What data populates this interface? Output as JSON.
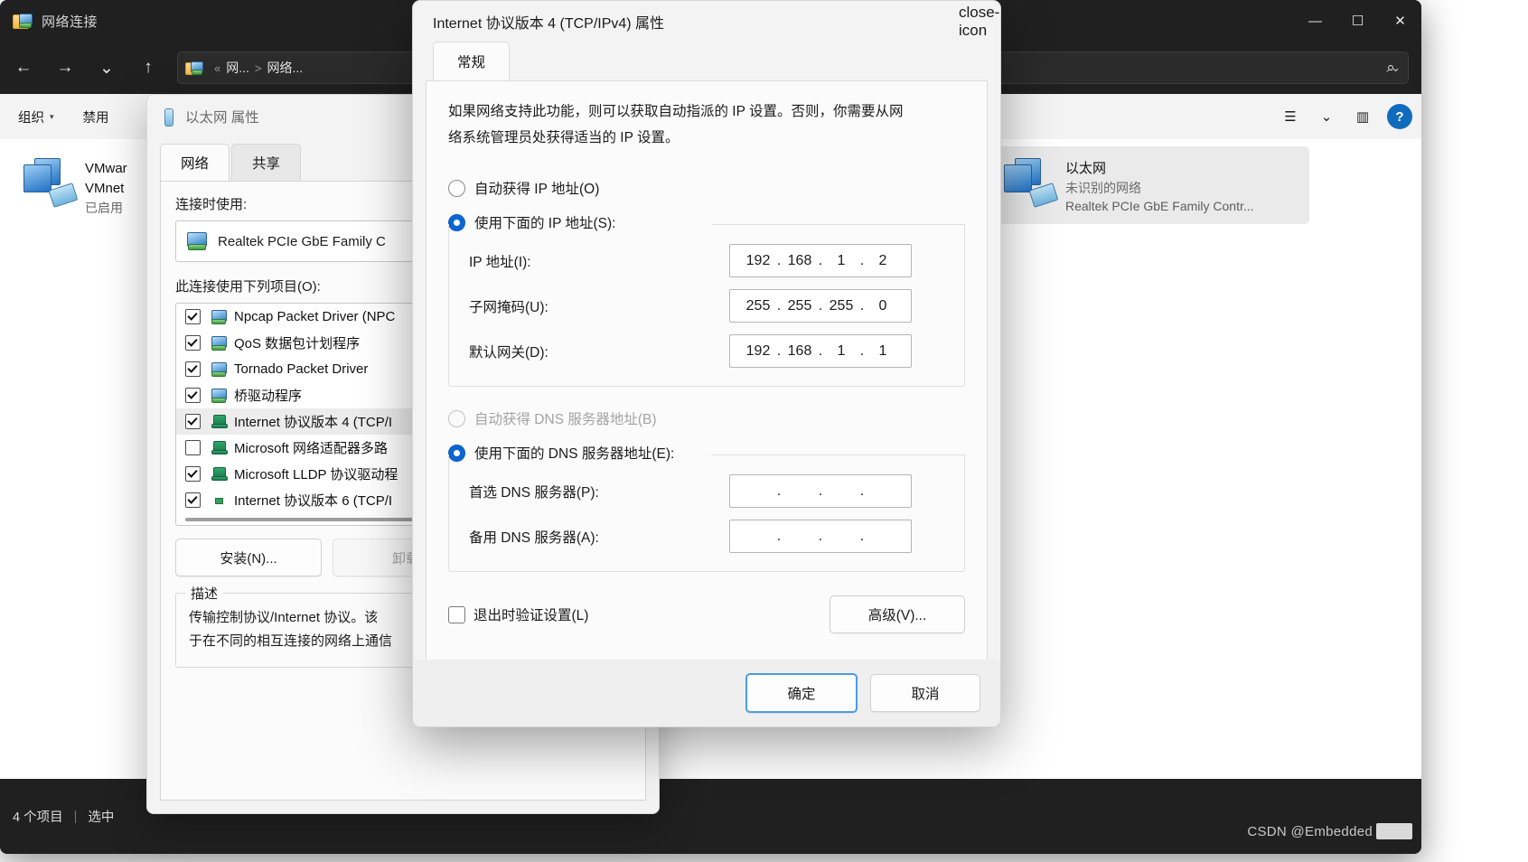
{
  "explorer": {
    "title": "网络连接",
    "title_icon": "network-folder-icon",
    "nav": {
      "back_icon": "arrow-left-icon",
      "forward_icon": "arrow-right-icon",
      "recent_icon": "chevron-down-icon",
      "up_icon": "arrow-up-icon",
      "search_icon": "search-icon"
    },
    "address": {
      "icon": "network-folder-icon",
      "overflow": "«",
      "crumb1": "网...",
      "separator": ">",
      "crumb2": "网络...",
      "chevron": "⌄"
    },
    "window_controls": {
      "minimize": "—",
      "maximize": "☐",
      "close": "✕"
    },
    "commandbar": {
      "organize": "组织",
      "organize_caret": "▾",
      "disable": "禁用",
      "view_icon": "view-options-icon",
      "view_caret": "▾",
      "pane_icon": "details-pane-icon",
      "help_icon": "?"
    },
    "items": [
      {
        "icon": "network-adapter-icon",
        "name": "VMwar",
        "name2": "VMnet",
        "status": "已启用"
      },
      {
        "icon": "network-adapter-icon",
        "name": "以太网",
        "status": "未识别的网络",
        "adapter": "Realtek PCIe GbE Family Contr..."
      }
    ],
    "statusbar": {
      "count": "4 个项目",
      "divider": "|",
      "selection": "选中"
    }
  },
  "ethernet_dialog": {
    "title": "以太网 属性",
    "title_icon": "network-cable-icon",
    "tabs": [
      {
        "label": "网络",
        "active": true
      },
      {
        "label": "共享",
        "active": false
      }
    ],
    "connect_using_label": "连接时使用:",
    "adapter": {
      "icon": "adapter-icon",
      "name": "Realtek PCIe GbE Family C"
    },
    "items_label": "此连接使用下列项目(O):",
    "protocols": [
      {
        "checked": true,
        "icon": "adapter-icon",
        "label": "Npcap Packet Driver (NPC",
        "selected": false
      },
      {
        "checked": true,
        "icon": "adapter-icon",
        "label": "QoS 数据包计划程序",
        "selected": false
      },
      {
        "checked": true,
        "icon": "adapter-icon",
        "label": "Tornado Packet Driver",
        "selected": false
      },
      {
        "checked": true,
        "icon": "adapter-icon",
        "label": "桥驱动程序",
        "selected": false
      },
      {
        "checked": true,
        "icon": "protocol-icon",
        "label": "Internet 协议版本 4 (TCP/I",
        "selected": true
      },
      {
        "checked": false,
        "icon": "protocol-icon",
        "label": "Microsoft 网络适配器多路",
        "selected": false
      },
      {
        "checked": true,
        "icon": "protocol-icon",
        "label": "Microsoft LLDP 协议驱动程",
        "selected": false
      },
      {
        "checked": true,
        "icon": "protocol-icon",
        "label": "Internet 协议版本 6 (TCP/I",
        "selected": false
      }
    ],
    "install_button": "安装(N)...",
    "uninstall_button": "卸载",
    "description_title": "描述",
    "description_line1": "传输控制协议/Internet 协议。该",
    "description_line2": "于在不同的相互连接的网络上通信"
  },
  "ipv4_dialog": {
    "title": "Internet 协议版本 4 (TCP/IPv4) 属性",
    "close_icon": "close-icon",
    "tab_general": "常规",
    "intro_line1": "如果网络支持此功能，则可以获取自动指派的 IP 设置。否则，你需要从网",
    "intro_line2": "络系统管理员处获得适当的 IP 设置。",
    "ip_auto_label": "自动获得 IP 地址(O)",
    "ip_manual_label": "使用下面的 IP 地址(S):",
    "ip_mode": "manual",
    "fields": [
      {
        "label": "IP 地址(I):",
        "octets": [
          "192",
          "168",
          "1",
          "2"
        ]
      },
      {
        "label": "子网掩码(U):",
        "octets": [
          "255",
          "255",
          "255",
          "0"
        ]
      },
      {
        "label": "默认网关(D):",
        "octets": [
          "192",
          "168",
          "1",
          "1"
        ]
      }
    ],
    "dns_auto_label": "自动获得 DNS 服务器地址(B)",
    "dns_manual_label": "使用下面的 DNS 服务器地址(E):",
    "dns_mode": "manual",
    "dns_fields": [
      {
        "label": "首选 DNS 服务器(P):",
        "octets": [
          "",
          "",
          "",
          ""
        ]
      },
      {
        "label": "备用 DNS 服务器(A):",
        "octets": [
          "",
          "",
          "",
          ""
        ]
      }
    ],
    "validate_checkbox_label": "退出时验证设置(L)",
    "validate_checked": false,
    "advanced_button": "高级(V)...",
    "ok_button": "确定",
    "cancel_button": "取消"
  },
  "watermark": {
    "text": "CSDN @Embedded"
  },
  "colors": {
    "accent": "#0b66cf",
    "primary_button_border": "#4a9bea",
    "titlebar_dark": "#202020",
    "dialog_bg": "#f3f3f3"
  }
}
